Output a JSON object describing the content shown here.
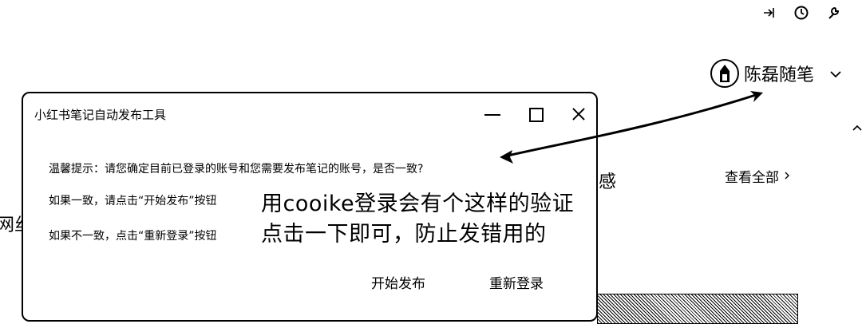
{
  "top_bar": {
    "icons": [
      "login-arrow-icon",
      "clock-icon",
      "wrench-icon"
    ]
  },
  "user": {
    "name": "陈磊随笔",
    "avatar_icon": "avatar-icon",
    "dropdown_icon": "chevron-down-icon"
  },
  "background": {
    "partial_text_left": "网丝",
    "partial_text_right": "感",
    "view_all": "查看全部",
    "view_all_icon": "chevron-right-icon"
  },
  "dialog": {
    "title": "小红书笔记自动发布工具",
    "warning": "温馨提示：请您确定目前已登录的账号和您需要发布笔记的账号，是否一致?",
    "if_same": "如果一致，请点击“开始发布”按钮",
    "if_different": "如果不一致，点击“重新登录”按钮",
    "start_button": "开始发布",
    "relogin_button": "重新登录"
  },
  "annotation": {
    "line1": "用cooike登录会有个这样的验证",
    "line2": "点击一下即可，防止发错用的"
  }
}
